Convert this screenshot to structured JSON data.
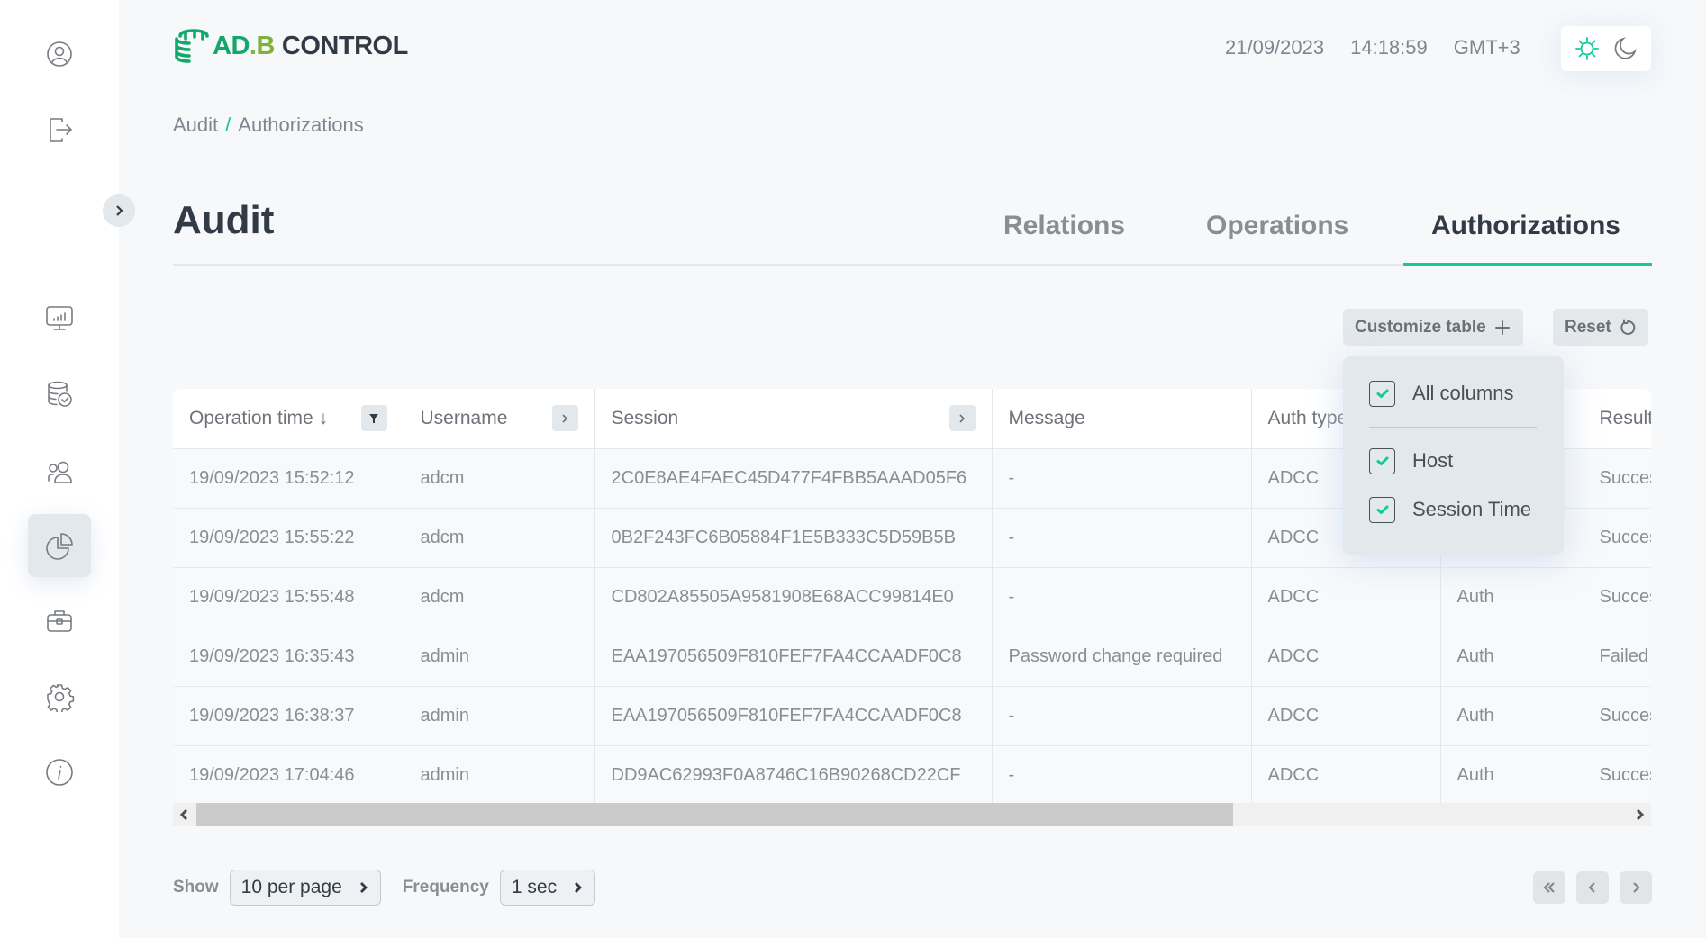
{
  "app": {
    "logo_ad": "AD",
    "logo_dot": ".",
    "logo_b": "B",
    "logo_control": "CONTROL"
  },
  "header": {
    "date": "21/09/2023",
    "time": "14:18:59",
    "timezone": "GMT+3",
    "theme_light_icon": "sun-icon",
    "theme_dark_icon": "moon-icon"
  },
  "sidebar": {
    "top_items": [
      {
        "icon": "user-circle-icon",
        "label": "Profile"
      },
      {
        "icon": "logout-icon",
        "label": "Logout"
      }
    ],
    "items": [
      {
        "icon": "monitor-chart-icon",
        "label": "Dashboard"
      },
      {
        "icon": "database-check-icon",
        "label": "Databases"
      },
      {
        "icon": "users-icon",
        "label": "Users"
      },
      {
        "icon": "pie-chart-icon",
        "label": "Audit",
        "active": true
      },
      {
        "icon": "briefcase-icon",
        "label": "Jobs"
      },
      {
        "icon": "gear-icon",
        "label": "Settings"
      },
      {
        "icon": "info-icon",
        "label": "Info"
      }
    ]
  },
  "breadcrumb": {
    "items": [
      "Audit",
      "Authorizations"
    ],
    "separator": "/"
  },
  "page": {
    "title": "Audit",
    "tabs": [
      {
        "label": "Relations",
        "active": false
      },
      {
        "label": "Operations",
        "active": false
      },
      {
        "label": "Authorizations",
        "active": true
      }
    ],
    "accent_color": "#12c99a"
  },
  "toolbar": {
    "customize_label": "Customize table",
    "reset_label": "Reset"
  },
  "column_popup": {
    "all_label": "All columns",
    "all_checked": true,
    "items": [
      {
        "label": "Host",
        "checked": true
      },
      {
        "label": "Session Time",
        "checked": true
      }
    ]
  },
  "table": {
    "columns": [
      {
        "label": "Operation time",
        "sort": "desc",
        "button": "filter"
      },
      {
        "label": "Username",
        "button": "expand"
      },
      {
        "label": "Session",
        "button": "expand"
      },
      {
        "label": "Message"
      },
      {
        "label": "Auth type"
      },
      {
        "label": ""
      },
      {
        "label": "Result"
      }
    ],
    "rows": [
      [
        "19/09/2023 15:52:12",
        "adcm",
        "2C0E8AE4FAEC45D477F4FBB5AAAD05F6",
        "-",
        "ADCC",
        "",
        "Success"
      ],
      [
        "19/09/2023 15:55:22",
        "adcm",
        "0B2F243FC6B05884F1E5B333C5D59B5B",
        "-",
        "ADCC",
        "",
        "Success"
      ],
      [
        "19/09/2023 15:55:48",
        "adcm",
        "CD802A85505A9581908E68ACC99814E0",
        "-",
        "ADCC",
        "Auth",
        "Success"
      ],
      [
        "19/09/2023 16:35:43",
        "admin",
        "EAA197056509F810FEF7FA4CCAADF0C8",
        "Password change required",
        "ADCC",
        "Auth",
        "Failed"
      ],
      [
        "19/09/2023 16:38:37",
        "admin",
        "EAA197056509F810FEF7FA4CCAADF0C8",
        "-",
        "ADCC",
        "Auth",
        "Success"
      ],
      [
        "19/09/2023 17:04:46",
        "admin",
        "DD9AC62993F0A8746C16B90268CD22CF",
        "-",
        "ADCC",
        "Auth",
        "Success"
      ]
    ]
  },
  "footer": {
    "show_label": "Show",
    "per_page_value": "10 per page",
    "frequency_label": "Frequency",
    "frequency_value": "1 sec"
  }
}
